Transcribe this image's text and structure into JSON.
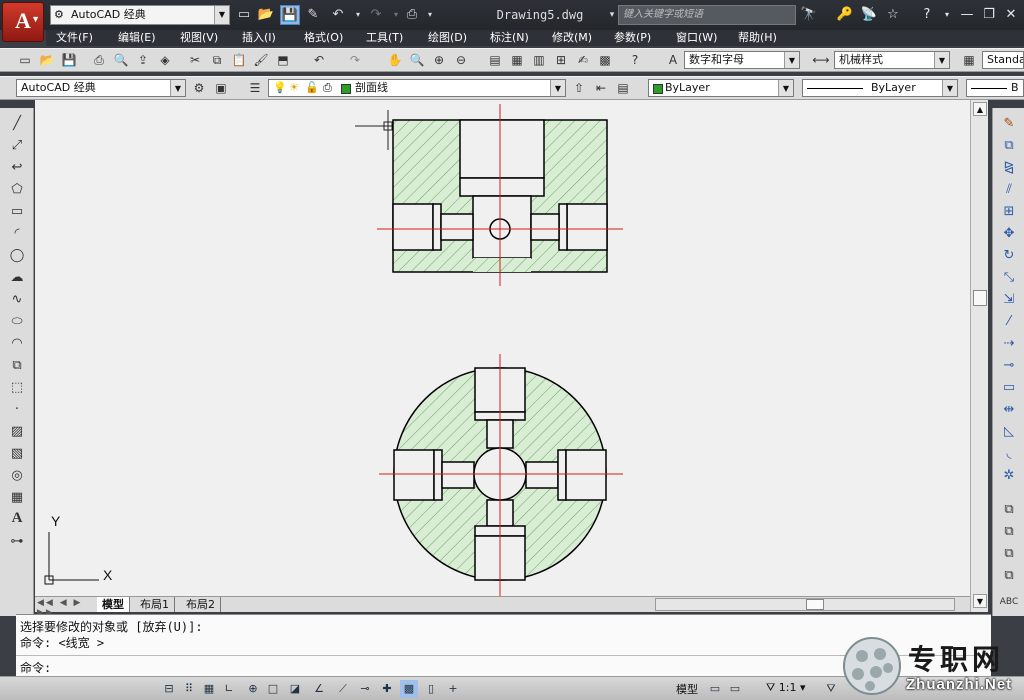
{
  "app": {
    "logo": "A",
    "workspace": "AutoCAD 经典",
    "document_title": "Drawing5.dwg",
    "search_placeholder": "键入关键字或短语"
  },
  "menu": [
    "文件(F)",
    "编辑(E)",
    "视图(V)",
    "插入(I)",
    "格式(O)",
    "工具(T)",
    "绘图(D)",
    "标注(N)",
    "修改(M)",
    "参数(P)",
    "窗口(W)",
    "帮助(H)"
  ],
  "toolbar2": {
    "text_style": "数字和字母",
    "dim_style": "机械样式",
    "table_style": "Standa"
  },
  "toolbar3": {
    "workspace": "AutoCAD 经典",
    "layer": "剖面线",
    "color": "ByLayer",
    "linetype": "ByLayer",
    "lineweight": "B"
  },
  "ucs": {
    "x_label": "X",
    "y_label": "Y"
  },
  "layout_tabs": [
    "模型",
    "布局1",
    "布局2"
  ],
  "command": {
    "line1": "选择要修改的对象或 [放弃(U)]:",
    "line2": "命令:  <线宽 >",
    "prompt": "命令:"
  },
  "status": {
    "space": "模型",
    "scale": "1:1"
  },
  "watermark": {
    "title": "专职网",
    "url": "Zhuanzhi.Net"
  },
  "colors": {
    "accent_red": "#d21a1a",
    "hatch": "#2e8b2e",
    "fill": "#d9ecd4"
  }
}
